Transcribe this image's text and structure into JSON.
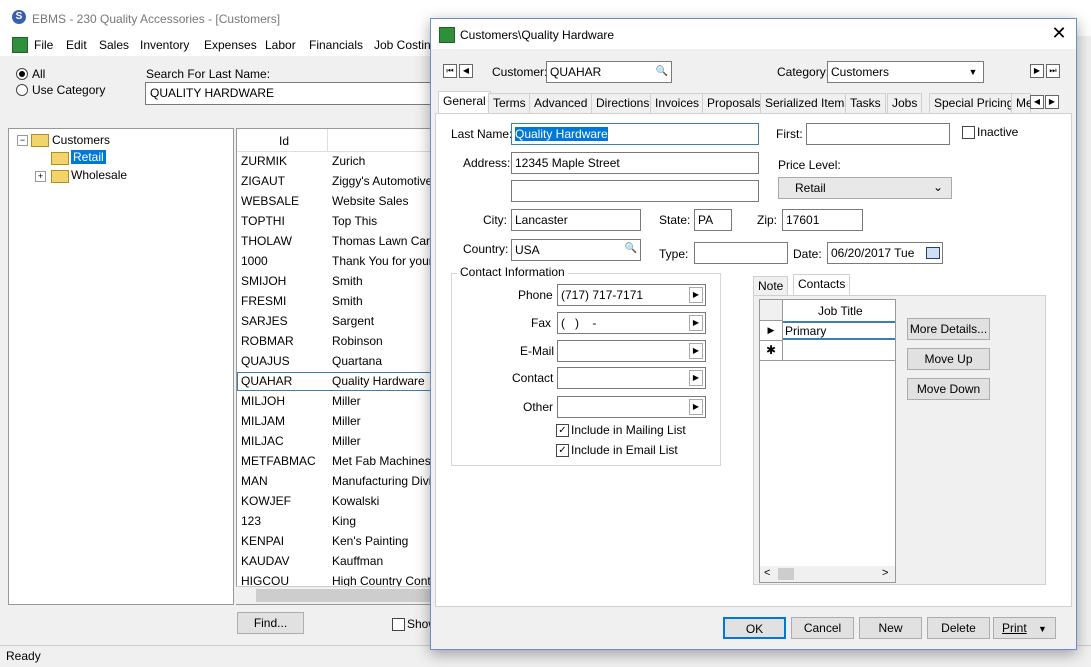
{
  "main": {
    "title": "EBMS - 230 Quality Accessories - [Customers]",
    "menu": [
      "File",
      "Edit",
      "Sales",
      "Inventory",
      "Expenses",
      "Labor",
      "Financials",
      "Job Costin"
    ],
    "filter": {
      "all_label": "All",
      "category_label": "Use Category",
      "search_label": "Search For Last Name:",
      "search_value": "QUALITY HARDWARE"
    },
    "tree": {
      "root": "Customers",
      "children": [
        "Retail",
        "Wholesale"
      ]
    },
    "list": {
      "header_id": "Id",
      "rows": [
        {
          "id": "ZURMIK",
          "name": "Zurich"
        },
        {
          "id": "ZIGAUT",
          "name": "Ziggy's Automotive"
        },
        {
          "id": "WEBSALE",
          "name": "Website Sales"
        },
        {
          "id": "TOPTHI",
          "name": "Top This"
        },
        {
          "id": "THOLAW",
          "name": "Thomas Lawn Care a"
        },
        {
          "id": "1000",
          "name": "Thank You for your F"
        },
        {
          "id": "SMIJOH",
          "name": "Smith"
        },
        {
          "id": "FRESMI",
          "name": "Smith"
        },
        {
          "id": "SARJES",
          "name": "Sargent"
        },
        {
          "id": "ROBMAR",
          "name": "Robinson"
        },
        {
          "id": "QUAJUS",
          "name": "Quartana"
        },
        {
          "id": "QUAHAR",
          "name": "Quality Hardware"
        },
        {
          "id": "MILJOH",
          "name": "Miller"
        },
        {
          "id": "MILJAM",
          "name": "Miller"
        },
        {
          "id": "MILJAC",
          "name": "Miller"
        },
        {
          "id": "METFABMAC",
          "name": "Met Fab Machines"
        },
        {
          "id": "MAN",
          "name": "Manufacturing Divisic"
        },
        {
          "id": "KOWJEF",
          "name": "Kowalski"
        },
        {
          "id": "123",
          "name": "King"
        },
        {
          "id": "KENPAI",
          "name": "Ken's Painting"
        },
        {
          "id": "KAUDAV",
          "name": "Kauffman"
        },
        {
          "id": "HIGCOU",
          "name": "High Country Contrac"
        }
      ]
    },
    "find_label": "Find...",
    "show_label": "Show",
    "status": "Ready"
  },
  "dialog": {
    "title": "Customers\\Quality Hardware",
    "customer_label": "Customer:",
    "customer_value": "QUAHAR",
    "category_label": "Category:",
    "category_value": "Customers",
    "tabs": [
      "General",
      "Terms",
      "Advanced",
      "Directions",
      "Invoices",
      "Proposals",
      "Serialized Items",
      "Tasks",
      "Jobs",
      "Special Pricing",
      "Me"
    ],
    "general": {
      "last_name_label": "Last Name:",
      "last_name_value": "Quality Hardware",
      "first_label": "First:",
      "first_value": "",
      "inactive_label": "Inactive",
      "address_label": "Address:",
      "address1": "12345 Maple Street",
      "address2": "",
      "price_level_label": "Price Level:",
      "price_level_value": "Retail",
      "city_label": "City:",
      "city_value": "Lancaster",
      "state_label": "State:",
      "state_value": "PA",
      "zip_label": "Zip:",
      "zip_value": "17601",
      "country_label": "Country:",
      "country_value": "USA",
      "type_label": "Type:",
      "type_value": "",
      "date_label": "Date:",
      "date_value": "06/20/2017 Tue",
      "contact_group_label": "Contact Information",
      "phone_label": "Phone",
      "phone_value": "(717) 717-7171",
      "fax_label": "Fax",
      "fax_value": "(   )    -",
      "email_label": "E-Mail",
      "email_value": "",
      "contact_label": "Contact",
      "contact_value": "",
      "other_label": "Other",
      "other_value": "",
      "mailing_label": "Include in Mailing List",
      "emaillist_label": "Include in Email List",
      "subtabs": [
        "Note",
        "Contacts"
      ],
      "contacts_header": "Job Title",
      "contacts_rows": [
        "Primary"
      ],
      "more_details_label": "More Details...",
      "move_up_label": "Move Up",
      "move_down_label": "Move Down"
    },
    "buttons": {
      "ok": "OK",
      "cancel": "Cancel",
      "new": "New",
      "delete": "Delete",
      "print": "Print"
    }
  }
}
